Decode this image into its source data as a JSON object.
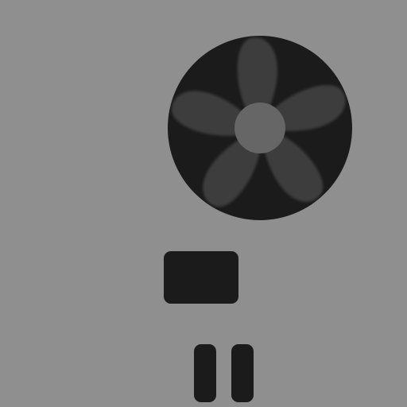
{
  "scene": {
    "background_color": "#8f8f8f",
    "fan": {
      "icon": "fan-icon",
      "body_color": "#1b1b1b",
      "blade_color": "#3c3c3c",
      "hub_color": "#666666",
      "blade_count": 5
    },
    "block": {
      "icon": "rounded-rectangle",
      "color": "#1b1b1b"
    },
    "slots": {
      "icon": "pause-bars",
      "color": "#1b1b1b",
      "count": 2
    }
  }
}
